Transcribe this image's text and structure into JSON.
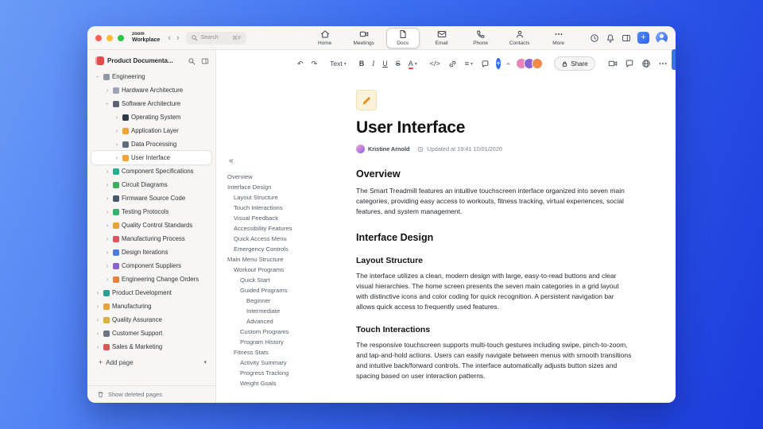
{
  "glyphs": {
    "plus": "+",
    "back": "‹",
    "forward": "›",
    "caret_down": "▾",
    "collapse_outline": "«"
  },
  "titlebar": {
    "brand_top": "zoom",
    "brand_bottom": "Workplace",
    "search_placeholder": "Search",
    "search_shortcut": "⌘F",
    "tabs": [
      {
        "label": "Home",
        "icon": "home",
        "active": false
      },
      {
        "label": "Meetings",
        "icon": "video",
        "active": false
      },
      {
        "label": "Docs",
        "icon": "doc",
        "active": true
      },
      {
        "label": "Email",
        "icon": "mail",
        "active": false
      },
      {
        "label": "Phone",
        "icon": "phone",
        "active": false
      },
      {
        "label": "Contacts",
        "icon": "person",
        "active": false
      },
      {
        "label": "More",
        "icon": "dots",
        "active": false
      }
    ],
    "right_icons": [
      "clock",
      "bell",
      "panel"
    ]
  },
  "sidebar": {
    "workspace_title": "Product Documenta...",
    "add_page_label": "Add page",
    "show_deleted_label": "Show deleted pages",
    "items": [
      {
        "label": "Engineering",
        "level": 0,
        "expanded": true,
        "icon_color": "#8f98a3"
      },
      {
        "label": "Hardware Architecture",
        "level": 1,
        "icon_color": "#9aa4b2"
      },
      {
        "label": "Software Architecture",
        "level": 1,
        "expanded": true,
        "icon_color": "#5b6472"
      },
      {
        "label": "Operating System",
        "level": 2,
        "icon_color": "#2f3a4a"
      },
      {
        "label": "Application Layer",
        "level": 2,
        "icon_color": "#f0a232"
      },
      {
        "label": "Data Processing",
        "level": 2,
        "icon_color": "#5f6d7e"
      },
      {
        "label": "User Interface",
        "level": 2,
        "selected": true,
        "icon_color": "#f2a43c"
      },
      {
        "label": "Component Specifications",
        "level": 1,
        "icon_color": "#27ae8f"
      },
      {
        "label": "Circuit Diagrams",
        "level": 1,
        "icon_color": "#3fae5a"
      },
      {
        "label": "Firmware Source Code",
        "level": 1,
        "icon_color": "#47566b"
      },
      {
        "label": "Testing Protocols",
        "level": 1,
        "icon_color": "#35b36b"
      },
      {
        "label": "Quality Control Standards",
        "level": 1,
        "icon_color": "#e9a13b"
      },
      {
        "label": "Manufacturing Process",
        "level": 1,
        "icon_color": "#d95757"
      },
      {
        "label": "Design Iterations",
        "level": 1,
        "icon_color": "#4a7ede"
      },
      {
        "label": "Component Suppliers",
        "level": 1,
        "icon_color": "#8a63d2"
      },
      {
        "label": "Engineering Change Orders",
        "level": 1,
        "icon_color": "#e8803a"
      },
      {
        "label": "Product Development",
        "level": 0,
        "icon_color": "#2f9e8f"
      },
      {
        "label": "Manufacturing",
        "level": 0,
        "icon_color": "#e9a13b"
      },
      {
        "label": "Quality Assurance",
        "level": 0,
        "icon_color": "#d9b13b"
      },
      {
        "label": "Customer Support",
        "level": 0,
        "icon_color": "#6b7683"
      },
      {
        "label": "Sales & Marketing",
        "level": 0,
        "icon_color": "#d95757"
      }
    ]
  },
  "toolbar": {
    "items": [
      {
        "name": "undo-button",
        "glyph": "↶"
      },
      {
        "name": "redo-button",
        "glyph": "↷"
      },
      {
        "divider": true
      },
      {
        "name": "text-style-select",
        "label": "Text",
        "caret": true
      },
      {
        "divider": true
      },
      {
        "name": "bold-button",
        "glyph": "B",
        "style": "bold"
      },
      {
        "name": "italic-button",
        "glyph": "I",
        "style": "italic"
      },
      {
        "name": "underline-button",
        "glyph": "U",
        "style": "underline"
      },
      {
        "name": "strikethrough-button",
        "glyph": "S",
        "style": "strike"
      },
      {
        "name": "text-color-button",
        "glyph": "A",
        "style": "colorA",
        "caret": true
      },
      {
        "divider": true
      },
      {
        "name": "code-button",
        "glyph": "</>"
      },
      {
        "name": "link-button",
        "icon": "link"
      },
      {
        "name": "list-button",
        "glyph": "≡",
        "caret": true
      },
      {
        "name": "comment-button",
        "icon": "bubble"
      },
      {
        "name": "insert-button",
        "special": "plus"
      },
      {
        "name": "collapse-toolbar-button",
        "special": "chevron-up"
      }
    ],
    "share_label": "Share",
    "avatars": [
      "#e884b6",
      "#8a63d2",
      "#f08a4b"
    ],
    "right_icons": [
      "video",
      "bubble",
      "globe",
      "dots"
    ]
  },
  "outline": {
    "items": [
      {
        "label": "Overview",
        "level": 0
      },
      {
        "label": "Interface Design",
        "level": 0
      },
      {
        "label": "Layout Structure",
        "level": 1
      },
      {
        "label": "Touch Interactions",
        "level": 1
      },
      {
        "label": "Visual Feedback",
        "level": 1
      },
      {
        "label": "Accessibility Features",
        "level": 1
      },
      {
        "label": "Quick Access Menu",
        "level": 1
      },
      {
        "label": "Emergency Controls",
        "level": 1
      },
      {
        "label": "Main Menu Structure",
        "level": 0
      },
      {
        "label": "Workout Programs",
        "level": 1
      },
      {
        "label": "Quick Start",
        "level": 2
      },
      {
        "label": "Guided Programs",
        "level": 2
      },
      {
        "label": "Beginner",
        "level": 3
      },
      {
        "label": "Intermediate",
        "level": 3
      },
      {
        "label": "Advanced",
        "level": 3
      },
      {
        "label": "Custom Programs",
        "level": 2
      },
      {
        "label": "Program History",
        "level": 2
      },
      {
        "label": "Fitness Stats",
        "level": 1
      },
      {
        "label": "Activity Summary",
        "level": 2
      },
      {
        "label": "Progress Tracking",
        "level": 2
      },
      {
        "label": "Weight Goals",
        "level": 2
      }
    ]
  },
  "document": {
    "title": "User Interface",
    "author": "Kristine Arnold",
    "updated": "Updated at 19:41 10/01/2020",
    "sections": [
      {
        "type": "h2",
        "text": "Overview"
      },
      {
        "type": "p",
        "text": "The Smart Treadmill features an intuitive touchscreen interface organized into seven main categories, providing easy access to workouts, fitness tracking, virtual experiences, social features, and system management."
      },
      {
        "type": "h2",
        "text": "Interface Design"
      },
      {
        "type": "h3",
        "text": "Layout Structure"
      },
      {
        "type": "p",
        "text": "The interface utilizes a clean, modern design with large, easy-to-read buttons and clear visual hierarchies. The home screen presents the seven main categories in a grid layout with distinctive icons and color coding for quick recognition. A persistent navigation bar allows quick access to frequently used features."
      },
      {
        "type": "h3",
        "text": "Touch Interactions"
      },
      {
        "type": "p",
        "text": "The responsive touchscreen supports multi-touch gestures including swipe, pinch-to-zoom, and tap-and-hold actions. Users can easily navigate between menus with smooth transitions and intuitive back/forward controls. The interface automatically adjusts button sizes and spacing based on user interaction patterns."
      }
    ]
  }
}
